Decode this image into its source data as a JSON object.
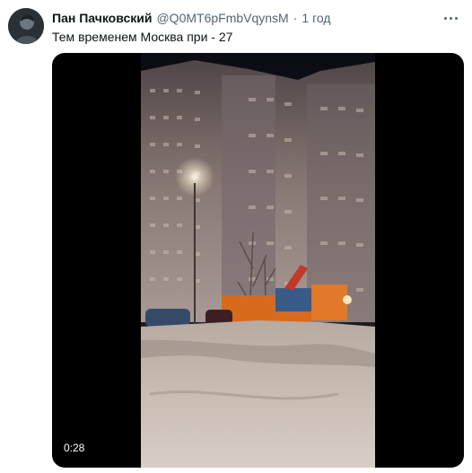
{
  "tweet": {
    "author_name": "Пан Пачковский",
    "handle": "@Q0MT6pFmbVqynsM",
    "separator": "·",
    "time": "1 год",
    "text": "Тем временем Москва при - 27"
  },
  "media": {
    "type": "video",
    "duration": "0:28"
  },
  "icons": {
    "more": "more-dots-icon",
    "avatar": "avatar-image"
  },
  "colors": {
    "secondary_text": "#536471",
    "primary_text": "#0f1419",
    "media_background": "#000000"
  }
}
